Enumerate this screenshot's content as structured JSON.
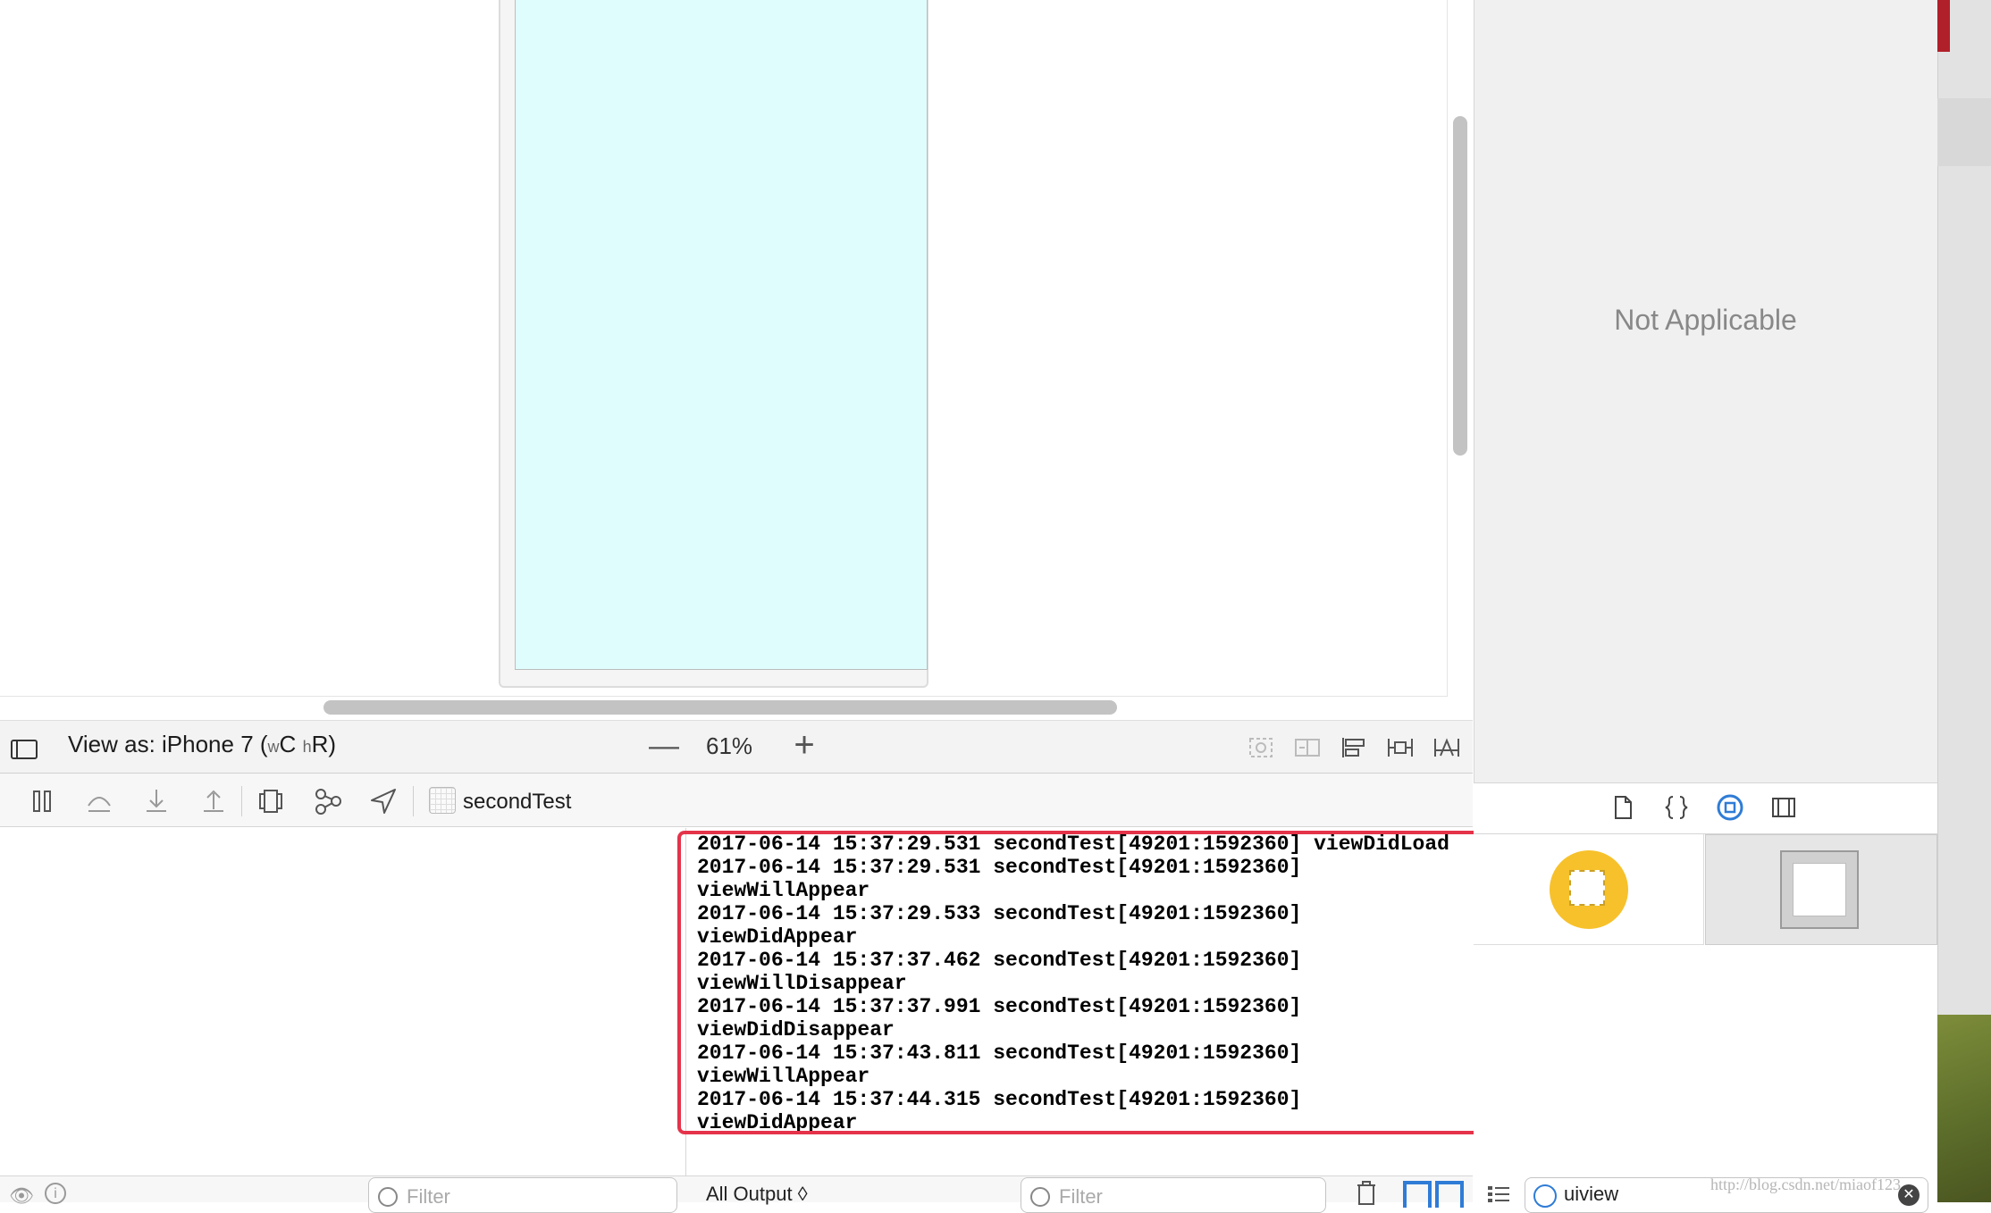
{
  "view_as": {
    "label": "View as: iPhone 7 (",
    "w_small": "w",
    "w_size": "C",
    "h_small": "h",
    "h_size": "R",
    "close_paren": ")",
    "zoom_out": "—",
    "zoom_level": "61%",
    "zoom_in": "+"
  },
  "debug_bar": {
    "target": "secondTest",
    "tools": [
      "pause-icon",
      "step-over-icon",
      "step-into-icon",
      "step-out-icon",
      "view-debugger-icon",
      "memory-graph-icon",
      "location-icon"
    ]
  },
  "console": {
    "output": "2017-06-14 15:37:29.531 secondTest[49201:1592360] viewDidLoad\n2017-06-14 15:37:29.531 secondTest[49201:1592360]\nviewWillAppear\n2017-06-14 15:37:29.533 secondTest[49201:1592360] viewDidAppear\n2017-06-14 15:37:37.462 secondTest[49201:1592360]\nviewWillDisappear\n2017-06-14 15:37:37.991 secondTest[49201:1592360]\nviewDidDisappear\n2017-06-14 15:37:43.811 secondTest[49201:1592360]\nviewWillAppear\n2017-06-14 15:37:44.315 secondTest[49201:1592360] viewDidAppear",
    "output_selector": "All Output ◊",
    "filter_placeholder": "Filter"
  },
  "variables": {
    "filter_placeholder": "Filter"
  },
  "inspector": {
    "message": "Not Applicable"
  },
  "library": {
    "tabs": [
      "file-template-icon",
      "code-snippet-icon",
      "object-library-icon",
      "media-library-icon"
    ],
    "filter_text": "uiview"
  },
  "watermark": "http://blog.csdn.net/miaof123",
  "colors": {
    "device_screen": "#e0fdfe",
    "highlight": "#e5334a",
    "accent": "#2f7cd6",
    "view_icon": "#f7c12b"
  }
}
